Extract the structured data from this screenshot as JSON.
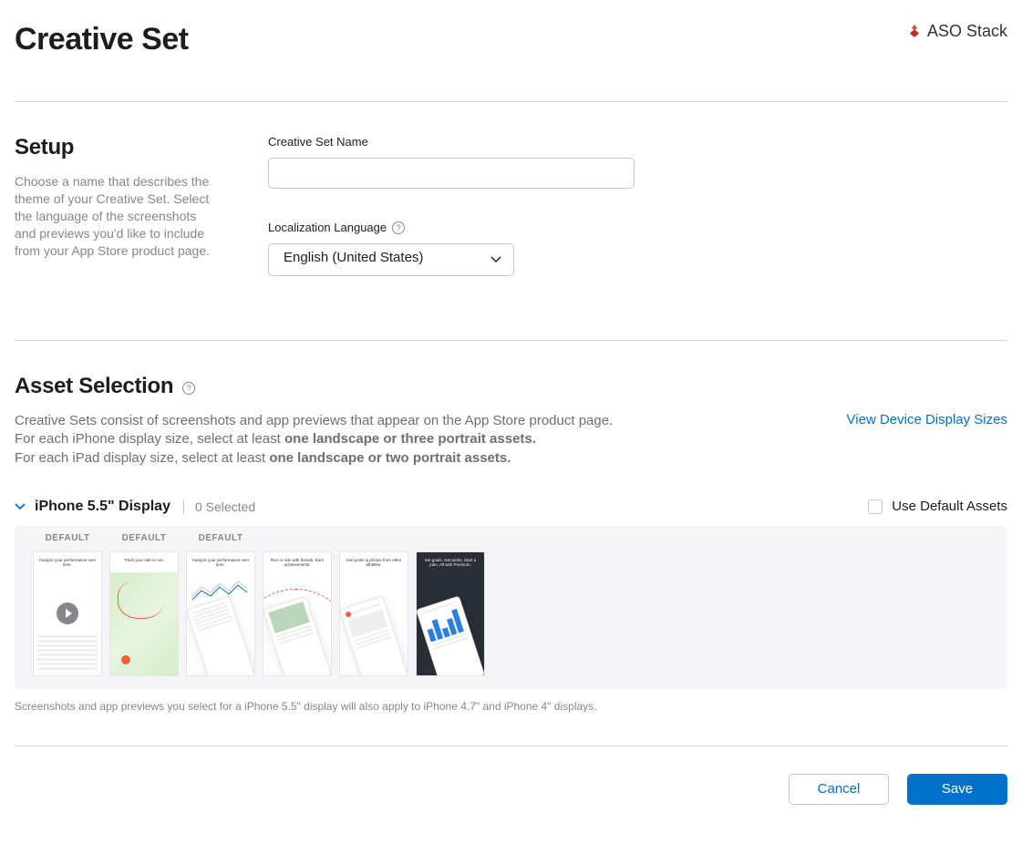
{
  "header": {
    "title": "Creative Set",
    "brand": "ASO Stack"
  },
  "setup": {
    "section_title": "Setup",
    "section_desc": "Choose a name that describes the theme of your Creative Set. Select the language of the screenshots and previews you'd like to include from your App Store product page.",
    "name_label": "Creative Set Name",
    "name_value": "",
    "language_label": "Localization Language",
    "language_value": "English (United States)"
  },
  "assets": {
    "section_title": "Asset Selection",
    "desc_line1": "Creative Sets consist of screenshots and app previews that appear on the App Store product page.",
    "desc_line2a": "For each iPhone display size, select at least ",
    "desc_line2b": "one landscape or three portrait assets.",
    "desc_line3a": "For each iPad display size, select at least ",
    "desc_line3b": "one landscape or two portrait assets.",
    "view_sizes_link": "View Device Display Sizes",
    "display": {
      "title": "iPhone 5.5\" Display",
      "selected_text": "0 Selected",
      "use_default_label": "Use Default Assets",
      "gallery": [
        {
          "label": "DEFAULT",
          "type": "video",
          "caption": "Analyze your performance over time."
        },
        {
          "label": "DEFAULT",
          "type": "map",
          "caption": "Track your ride or run."
        },
        {
          "label": "DEFAULT",
          "type": "chart",
          "caption": "Analyze your performance over time."
        },
        {
          "label": "",
          "type": "social",
          "caption": "Run or ride with friends. Earn achievements."
        },
        {
          "label": "",
          "type": "feed",
          "caption": "See posts & photos from other athletes."
        },
        {
          "label": "",
          "type": "dark",
          "caption": "Set goals. Get perks. Start a plan. All with Premium."
        }
      ],
      "note": "Screenshots and app previews you select for a iPhone 5.5\" display will also apply to iPhone 4.7\" and iPhone 4\" displays."
    }
  },
  "footer": {
    "cancel": "Cancel",
    "save": "Save"
  }
}
